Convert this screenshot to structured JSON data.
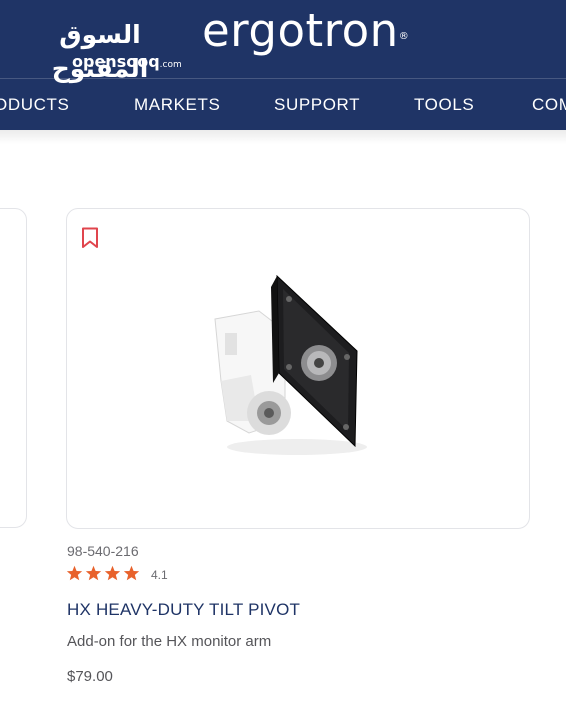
{
  "header": {
    "opensooq_logo_arabic": "السوق المفتوح",
    "opensooq_logo_latin": "opensooq",
    "opensooq_logo_tld": ".com",
    "brand": "ergotron",
    "brand_mark": "®",
    "nav": [
      "ODUCTS",
      "MARKETS",
      "SUPPORT",
      "TOOLS",
      "COM"
    ]
  },
  "product": {
    "sku": "98-540-216",
    "rating": 4.1,
    "rating_label": "4.1",
    "title": "HX HEAVY-DUTY TILT PIVOT",
    "description": "Add-on for the HX monitor arm",
    "price": "$79.00",
    "bookmark_icon": "bookmark-icon"
  },
  "colors": {
    "header_bg": "#1f3466",
    "star": "#e8622c",
    "bookmark": "#e0454d",
    "title": "#1f3466"
  }
}
